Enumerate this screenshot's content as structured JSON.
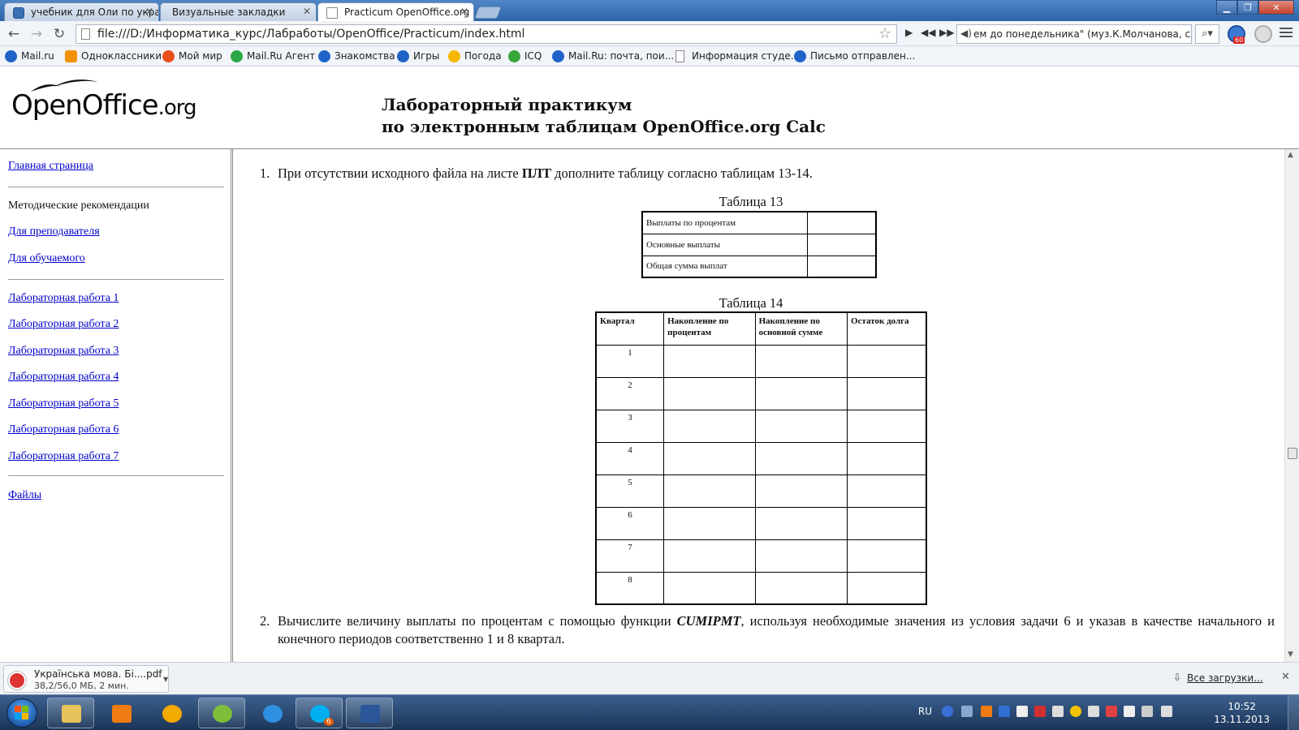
{
  "browser": {
    "tabs": [
      {
        "title": "учебник для Оли по укра"
      },
      {
        "title": "Визуальные закладки"
      },
      {
        "title": "Practicum OpenOffice.org"
      }
    ],
    "url": "file:///D:/Информатика_курс/Лабработы/OpenOffice/Practicum/index.html",
    "radio_text": "ем до понедельника\" (муз.К.Молчанова, сл.",
    "ext_badge": "60",
    "bookmarks": [
      {
        "label": "Mail.ru",
        "color": "#1e64c8"
      },
      {
        "label": "Одноклассники",
        "color": "#f39200"
      },
      {
        "label": "Мой мир",
        "color": "#e94e1b"
      },
      {
        "label": "Mail.Ru Агент",
        "color": "#2aa845"
      },
      {
        "label": "Знакомства",
        "color": "#1e64c8"
      },
      {
        "label": "Игры",
        "color": "#1e64c8"
      },
      {
        "label": "Погода",
        "color": "#f6b700"
      },
      {
        "label": "ICQ",
        "color": "#3aa63a"
      },
      {
        "label": "Mail.Ru: почта, пои...",
        "color": "#1e64c8"
      },
      {
        "label": "Информация студе...",
        "color": "#ffffff"
      },
      {
        "label": "Письмо отправлен...",
        "color": "#1e64c8"
      }
    ]
  },
  "header": {
    "logo_main": "OpenOffice",
    "logo_suffix": ".org",
    "title_line1": "Лабораторный практикум",
    "title_line2": "по электронным таблицам OpenOffice.org Calc"
  },
  "sidebar": {
    "home": "Главная страница",
    "method_heading": "Методические рекомендации",
    "for_teacher": "Для преподавателя",
    "for_student": "Для обучаемого",
    "labs": [
      "Лабораторная работа 1",
      "Лабораторная работа 2",
      "Лабораторная работа 3",
      "Лабораторная работа 4",
      "Лабораторная работа 5",
      "Лабораторная работа 6",
      "Лабораторная работа 7"
    ],
    "files": "Файлы"
  },
  "content": {
    "item1_num": "1.",
    "item1_pre": "При отсутствии исходного файла на листе ",
    "item1_bold": "ПЛТ",
    "item1_post": " дополните таблицу согласно таблицам 13-14.",
    "table13_caption": "Таблица 13",
    "table13_rows": [
      "Выплаты по процентам",
      "Основные выплаты",
      "Общая сумма выплат"
    ],
    "table14_caption": "Таблица 14",
    "table14_headers": [
      "Квартал",
      "Накопление по процентам",
      "Накопление по основной сумме",
      "Остаток долга"
    ],
    "table14_quarters": [
      "1",
      "2",
      "3",
      "4",
      "5",
      "6",
      "7",
      "8"
    ],
    "item2_num": "2.",
    "item2_pre": "Вычислите величину выплаты по процентам с помощью функции ",
    "item2_func": "CUMIPMT",
    "item2_post": ", используя необходимые значения из условия задачи 6 и указав в качестве начального и конечного периодов соответственно 1 и 8 квартал."
  },
  "downloads": {
    "file_name": "Українська мова. Бі....pdf",
    "file_status": "38,2/56,0 МБ, 2 мин.",
    "show_all": "Все загрузки..."
  },
  "taskbar": {
    "lang": "RU",
    "skype_badge": "6",
    "time": "10:52",
    "date": "13.11.2013"
  },
  "colors": {
    "link": "#0000cc",
    "taskbar": "#1c3558"
  }
}
